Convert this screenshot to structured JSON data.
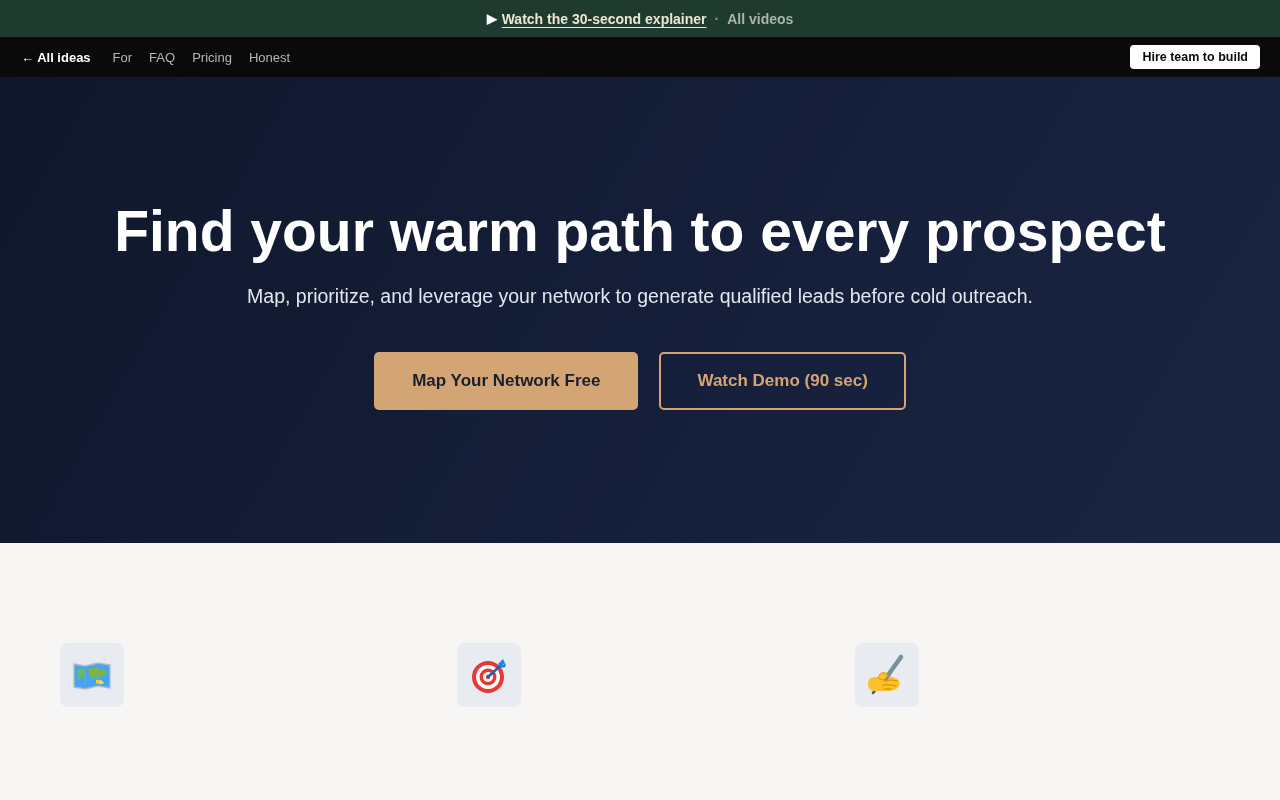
{
  "banner": {
    "play_icon": "▶",
    "link": "Watch the 30-second explainer",
    "separator": "·",
    "all_videos": "All videos"
  },
  "nav": {
    "back": "← All ideas",
    "links": [
      {
        "label": "For"
      },
      {
        "label": "FAQ"
      },
      {
        "label": "Pricing"
      },
      {
        "label": "Honest"
      }
    ],
    "cta": "Hire team to build"
  },
  "hero": {
    "title": "Find your warm path to every prospect",
    "subtitle": "Map, prioritize, and leverage your network to generate qualified leads before cold outreach.",
    "buttons": [
      {
        "label": "Map Your Network Free",
        "kind": "primary"
      },
      {
        "label": "Watch Demo (90 sec)",
        "kind": "secondary"
      }
    ]
  },
  "features": [
    {
      "kind": "map"
    },
    {
      "kind": "target"
    },
    {
      "kind": "writing"
    }
  ]
}
